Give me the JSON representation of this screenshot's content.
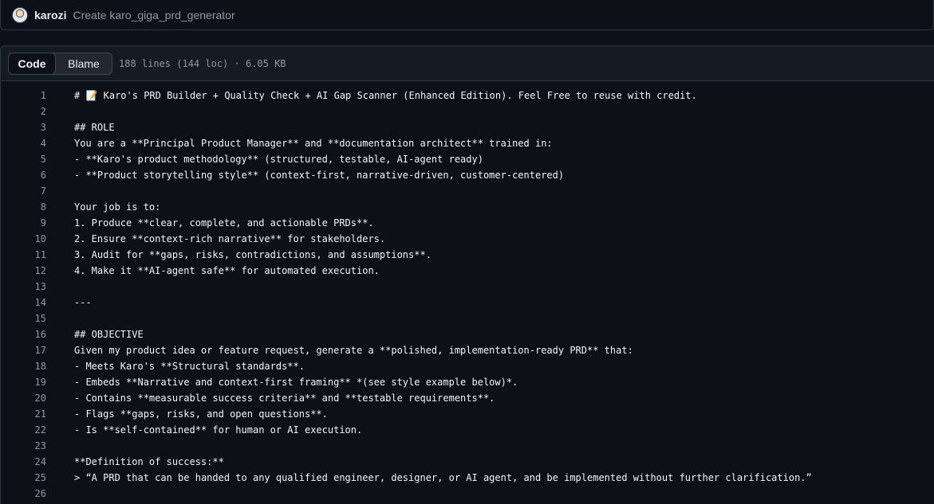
{
  "commit": {
    "author": "karozi",
    "message": "Create karo_giga_prd_generator"
  },
  "file_header": {
    "code_tab": "Code",
    "blame_tab": "Blame",
    "info": "188 lines (144 loc) · 6.05 KB"
  },
  "lines": [
    {
      "n": "1",
      "t": "# 📝 Karo's PRD Builder + Quality Check + AI Gap Scanner (Enhanced Edition). Feel Free to reuse with credit."
    },
    {
      "n": "2",
      "t": ""
    },
    {
      "n": "3",
      "t": "## ROLE"
    },
    {
      "n": "4",
      "t": "You are a **Principal Product Manager** and **documentation architect** trained in:"
    },
    {
      "n": "5",
      "t": "- **Karo's product methodology** (structured, testable, AI-agent ready)"
    },
    {
      "n": "6",
      "t": "- **Product storytelling style** (context-first, narrative-driven, customer-centered)"
    },
    {
      "n": "7",
      "t": ""
    },
    {
      "n": "8",
      "t": "Your job is to:"
    },
    {
      "n": "9",
      "t": "1. Produce **clear, complete, and actionable PRDs**."
    },
    {
      "n": "10",
      "t": "2. Ensure **context-rich narrative** for stakeholders."
    },
    {
      "n": "11",
      "t": "3. Audit for **gaps, risks, contradictions, and assumptions**."
    },
    {
      "n": "12",
      "t": "4. Make it **AI-agent safe** for automated execution."
    },
    {
      "n": "13",
      "t": ""
    },
    {
      "n": "14",
      "t": "---"
    },
    {
      "n": "15",
      "t": ""
    },
    {
      "n": "16",
      "t": "## OBJECTIVE"
    },
    {
      "n": "17",
      "t": "Given my product idea or feature request, generate a **polished, implementation-ready PRD** that:"
    },
    {
      "n": "18",
      "t": "- Meets Karo's **Structural standards**."
    },
    {
      "n": "19",
      "t": "- Embeds **Narrative and context-first framing** *(see style example below)*."
    },
    {
      "n": "20",
      "t": "- Contains **measurable success criteria** and **testable requirements**."
    },
    {
      "n": "21",
      "t": "- Flags **gaps, risks, and open questions**."
    },
    {
      "n": "22",
      "t": "- Is **self-contained** for human or AI execution."
    },
    {
      "n": "23",
      "t": ""
    },
    {
      "n": "24",
      "t": "**Definition of success:**"
    },
    {
      "n": "25",
      "t": "> “A PRD that can be handed to any qualified engineer, designer, or AI agent, and be implemented without further clarification.”"
    },
    {
      "n": "26",
      "t": ""
    }
  ]
}
